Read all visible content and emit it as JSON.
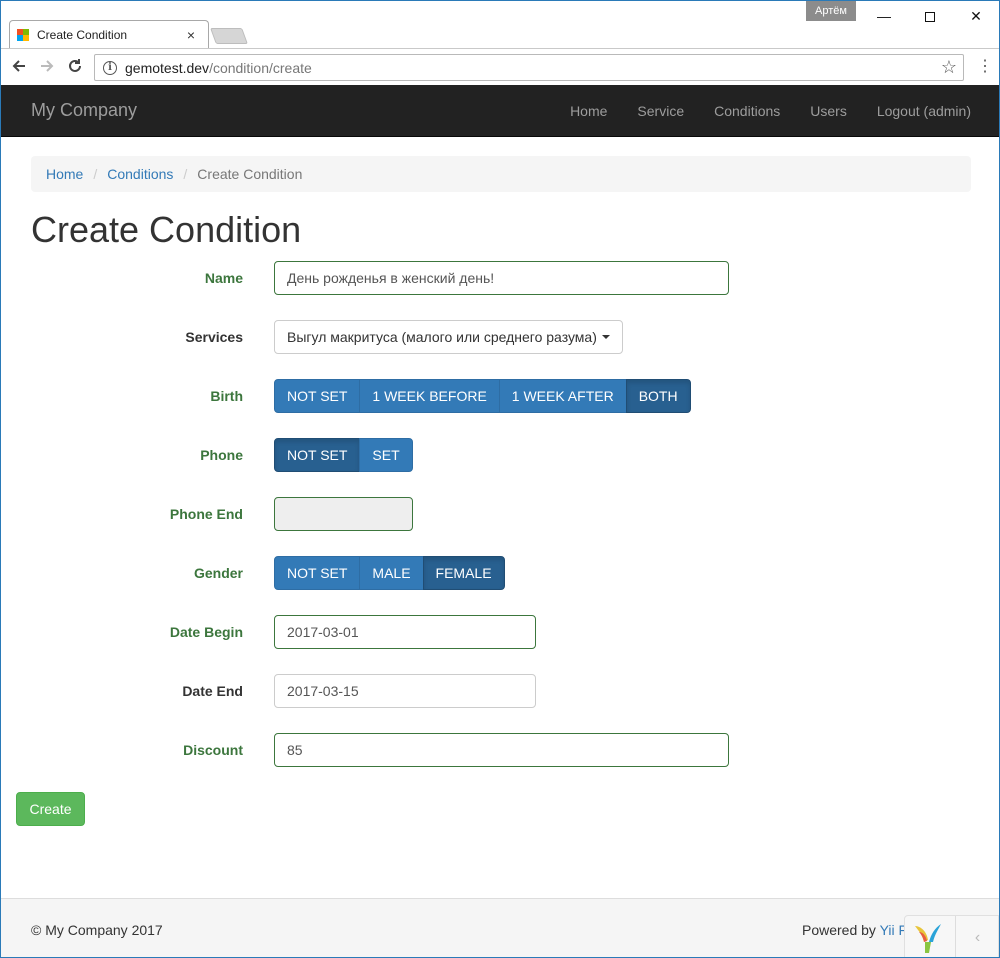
{
  "browser": {
    "tab_title": "Create Condition",
    "tab_close": "×",
    "user_badge": "Артём",
    "url_host": "gemotest.dev",
    "url_path": "/condition/create",
    "win_min": "—",
    "win_close": "✕"
  },
  "navbar": {
    "brand": "My Company",
    "links": [
      "Home",
      "Service",
      "Conditions",
      "Users",
      "Logout (admin)"
    ]
  },
  "breadcrumb": {
    "items": [
      "Home",
      "Conditions"
    ],
    "separator": "/",
    "active": "Create Condition"
  },
  "page_title": "Create Condition",
  "form": {
    "name": {
      "label": "Name",
      "value": "День рожденья в женский день!"
    },
    "services": {
      "label": "Services",
      "value": "Выгул макритуса (малого или среднего разума)"
    },
    "birth": {
      "label": "Birth",
      "options": [
        "NOT SET",
        "1 WEEK BEFORE",
        "1 WEEK AFTER",
        "BOTH"
      ],
      "selected": "BOTH"
    },
    "phone": {
      "label": "Phone",
      "options": [
        "NOT SET",
        "SET"
      ],
      "selected": "NOT SET"
    },
    "phone_end": {
      "label": "Phone End",
      "value": ""
    },
    "gender": {
      "label": "Gender",
      "options": [
        "NOT SET",
        "MALE",
        "FEMALE"
      ],
      "selected": "FEMALE"
    },
    "date_begin": {
      "label": "Date Begin",
      "value": "2017-03-01"
    },
    "date_end": {
      "label": "Date End",
      "value": "2017-03-15"
    },
    "discount": {
      "label": "Discount",
      "value": "85"
    },
    "submit": "Create"
  },
  "footer": {
    "copyright": "© My Company 2017",
    "powered_prefix": "Powered by ",
    "powered_link": "Yii F"
  },
  "colors": {
    "primary": "#337ab7",
    "primary_active": "#286090",
    "success": "#5cb85c",
    "valid_label": "#3c763d",
    "navbar_bg": "#222222"
  }
}
